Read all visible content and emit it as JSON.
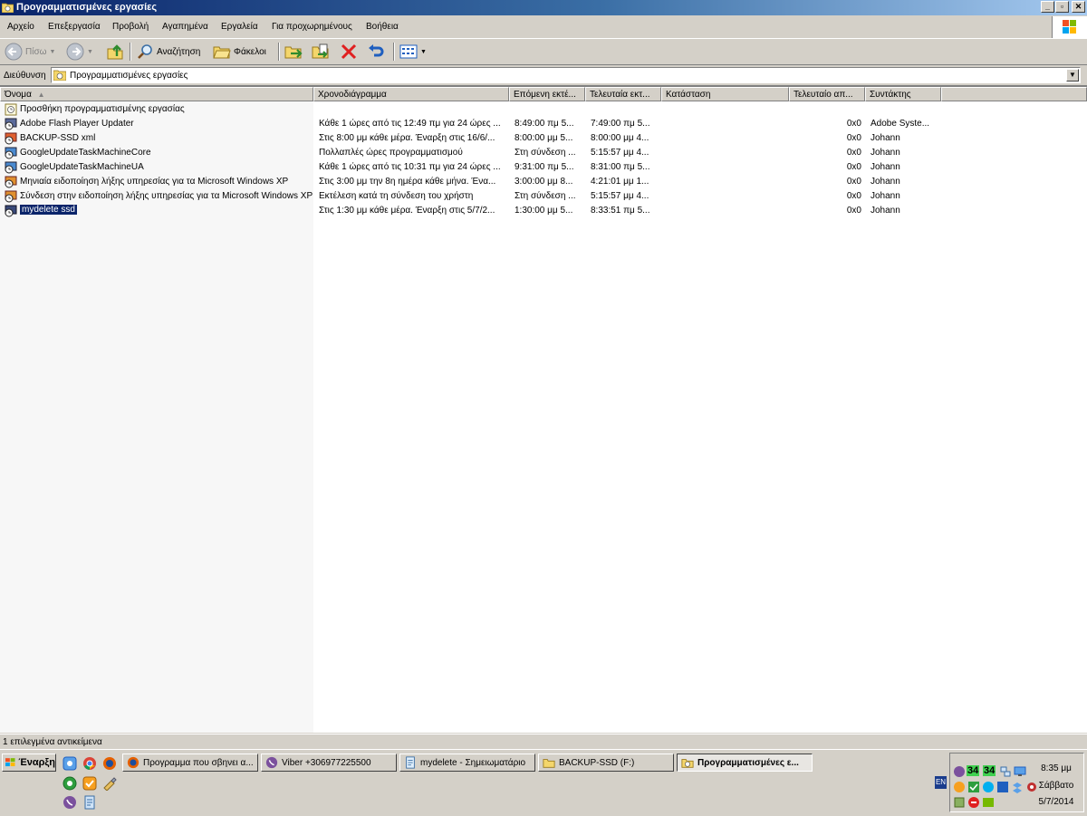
{
  "window": {
    "title": "Προγραμματισμένες εργασίες",
    "btn_min": "_",
    "btn_max": "▫",
    "btn_close": "✕"
  },
  "menu": [
    "Αρχείο",
    "Επεξεργασία",
    "Προβολή",
    "Αγαπημένα",
    "Εργαλεία",
    "Για προχωρημένους",
    "Βοήθεια"
  ],
  "toolbar": {
    "back": "Πίσω",
    "search": "Αναζήτηση",
    "folders": "Φάκελοι"
  },
  "address": {
    "label": "Διεύθυνση",
    "value": "Προγραμματισμένες εργασίες"
  },
  "columns": [
    "Όνομα",
    "Χρονοδιάγραμμα",
    "Επόμενη εκτέ...",
    "Τελευταία εκτ...",
    "Κατάσταση",
    "Τελευταίο απ...",
    "Συντάκτης"
  ],
  "add_task": "Προσθήκη προγραμματισμένης εργασίας",
  "rows": [
    {
      "name": "Adobe Flash Player Updater",
      "schedule": "Κάθε 1 ώρες από τις 12:49 πμ για 24 ώρες ...",
      "next": "8:49:00 πμ  5...",
      "last": "7:49:00 πμ  5...",
      "status": "",
      "result": "0x0",
      "author": "Adobe Syste..."
    },
    {
      "name": "BACKUP-SSD xml",
      "schedule": "Στις 8:00 μμ κάθε μέρα. Έναρξη στις 16/6/...",
      "next": "8:00:00 μμ  5...",
      "last": "8:00:00 μμ  4...",
      "status": "",
      "result": "0x0",
      "author": "Johann"
    },
    {
      "name": "GoogleUpdateTaskMachineCore",
      "schedule": "Πολλαπλές ώρες προγραμματισμού",
      "next": "Στη σύνδεση ...",
      "last": "5:15:57 μμ  4...",
      "status": "",
      "result": "0x0",
      "author": "Johann"
    },
    {
      "name": "GoogleUpdateTaskMachineUA",
      "schedule": "Κάθε 1 ώρες από τις 10:31 πμ για 24 ώρες ...",
      "next": "9:31:00 πμ  5...",
      "last": "8:31:00 πμ  5...",
      "status": "",
      "result": "0x0",
      "author": "Johann"
    },
    {
      "name": "Μηνιαία ειδοποίηση λήξης υπηρεσίας για τα Microsoft Windows XP",
      "schedule": "Στις 3:00 μμ την 8η ημέρα κάθε μήνα. Ένα...",
      "next": "3:00:00 μμ  8...",
      "last": "4:21:01 μμ  1...",
      "status": "",
      "result": "0x0",
      "author": "Johann"
    },
    {
      "name": "Σύνδεση στην ειδοποίηση λήξης υπηρεσίας για τα Microsoft Windows XP",
      "schedule": "Εκτέλεση κατά τη σύνδεση του χρήστη",
      "next": "Στη σύνδεση ...",
      "last": "5:15:57 μμ  4...",
      "status": "",
      "result": "0x0",
      "author": "Johann"
    },
    {
      "name": "mydelete ssd",
      "schedule": "Στις 1:30 μμ κάθε μέρα. Έναρξη στις 5/7/2...",
      "next": "1:30:00 μμ  5...",
      "last": "8:33:51 πμ  5...",
      "status": "",
      "result": "0x0",
      "author": "Johann"
    }
  ],
  "status_bar": "1 επιλεγμένα αντικείμενα",
  "taskbar": {
    "start": "Έναρξη",
    "buttons": [
      "Προγραμμα που σβηνει α...",
      "Viber +306977225500",
      "mydelete - Σημειωματάριο",
      "BACKUP-SSD (F:)",
      "Προγραμματισμένες ε..."
    ],
    "lang": "EN",
    "tray_num1": "34",
    "tray_num2": "34",
    "time": "8:35 μμ",
    "day": "Σάββατο",
    "date": "5/7/2014"
  }
}
